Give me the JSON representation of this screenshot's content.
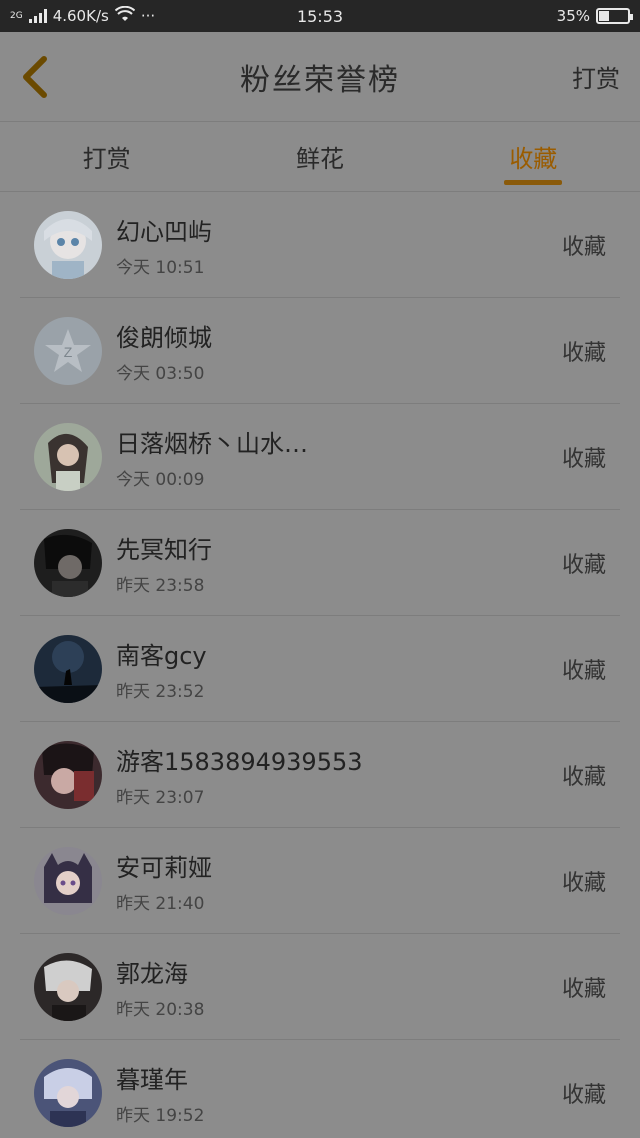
{
  "status": {
    "network": "2G",
    "speed": "4.60K/s",
    "more": "···",
    "time": "15:53",
    "battery": "35%",
    "battery_level": 0.35
  },
  "header": {
    "title": "粉丝荣誉榜",
    "action": "打赏"
  },
  "tabs": [
    {
      "label": "打赏",
      "active": false
    },
    {
      "label": "鲜花",
      "active": false
    },
    {
      "label": "收藏",
      "active": true
    }
  ],
  "accent_color": "#8a5a0a",
  "rows": [
    {
      "name": "幻心凹屿",
      "time": "今天 10:51",
      "action": "收藏"
    },
    {
      "name": "俊朗倾城",
      "time": "今天 03:50",
      "action": "收藏"
    },
    {
      "name": "日落烟桥丶山水…",
      "time": "今天 00:09",
      "action": "收藏"
    },
    {
      "name": "先冥知行",
      "time": "昨天 23:58",
      "action": "收藏"
    },
    {
      "name": "南客gcy",
      "time": "昨天 23:52",
      "action": "收藏"
    },
    {
      "name": "游客1583894939553",
      "time": "昨天 23:07",
      "action": "收藏"
    },
    {
      "name": "安可莉娅",
      "time": "昨天 21:40",
      "action": "收藏"
    },
    {
      "name": "郭龙海",
      "time": "昨天 20:38",
      "action": "收藏"
    },
    {
      "name": "暮瑾年",
      "time": "昨天 19:52",
      "action": "收藏"
    }
  ]
}
